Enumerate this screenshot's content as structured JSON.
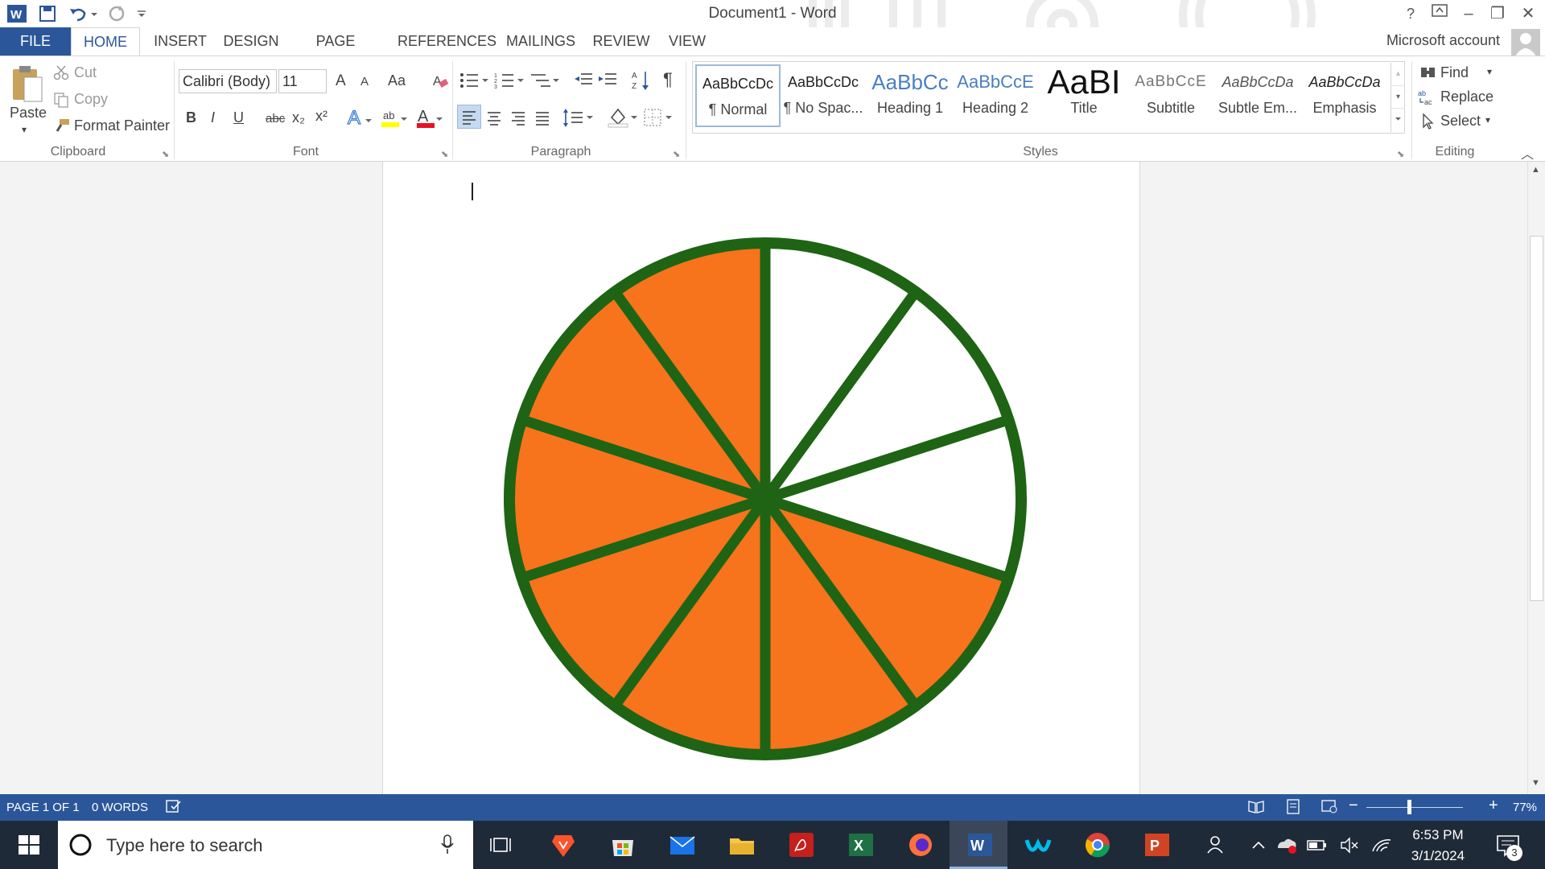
{
  "window": {
    "title": "Document1 - Word",
    "help": "?",
    "minimize": "–",
    "restore": "❐",
    "close": "✕"
  },
  "tabs": [
    "FILE",
    "HOME",
    "INSERT",
    "DESIGN",
    "PAGE LAYOUT",
    "REFERENCES",
    "MAILINGS",
    "REVIEW",
    "VIEW"
  ],
  "account": "Microsoft account",
  "clipboard": {
    "paste": "Paste",
    "cut": "Cut",
    "copy": "Copy",
    "format_painter": "Format Painter",
    "label": "Clipboard"
  },
  "font": {
    "name": "Calibri (Body)",
    "size": "11",
    "grow": "A",
    "shrink": "A",
    "case": "Aa",
    "bold": "B",
    "italic": "I",
    "underline": "U",
    "strikethrough": "abc",
    "subscript": "x₂",
    "superscript": "x²",
    "label": "Font"
  },
  "paragraph": {
    "label": "Paragraph",
    "pilcrow": "¶"
  },
  "styles": {
    "label": "Styles",
    "items": [
      {
        "sample": "AaBbCcDc",
        "name": "¶ Normal"
      },
      {
        "sample": "AaBbCcDc",
        "name": "¶ No Spac..."
      },
      {
        "sample": "AaBbCc",
        "name": "Heading 1"
      },
      {
        "sample": "AaBbCcE",
        "name": "Heading 2"
      },
      {
        "sample": "AaBI",
        "name": "Title"
      },
      {
        "sample": "AaBbCcE",
        "name": "Subtitle"
      },
      {
        "sample": "AaBbCcDa",
        "name": "Subtle Em..."
      },
      {
        "sample": "AaBbCcDa",
        "name": "Emphasis"
      }
    ]
  },
  "editing": {
    "find": "Find",
    "replace": "Replace",
    "select": "Select",
    "label": "Editing"
  },
  "drawing": {
    "slices": 10,
    "filled_orange": 7,
    "filled_white": 3,
    "fill_color": "#f7731c",
    "stroke_color": "#1e6414"
  },
  "status": {
    "page": "PAGE 1 OF 1",
    "words": "0 WORDS",
    "zoom": "77%",
    "zoom_minus": "−",
    "zoom_plus": "+"
  },
  "taskbar": {
    "search_placeholder": "Type here to search",
    "time": "6:53 PM",
    "date": "3/1/2024",
    "notifications": "3"
  }
}
